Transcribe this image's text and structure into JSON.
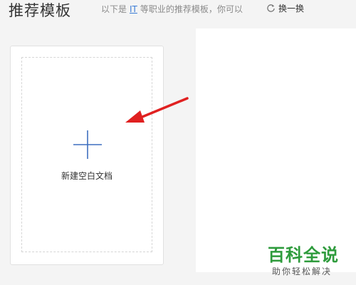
{
  "header": {
    "title": "推荐模板",
    "subtitle_before": "以下是",
    "subtitle_link": "IT",
    "subtitle_after": "等职业的推荐模板，你可以",
    "swap_label": "换一换",
    "swap_icon": "refresh-icon"
  },
  "blank_card": {
    "label": "新建空白文档",
    "icon": "plus-icon",
    "plus_color": "#3f6fbf"
  },
  "annotation": {
    "arrow_color": "#e02020"
  },
  "watermark": {
    "main": "百科全说",
    "sub": "助你轻松解决"
  }
}
